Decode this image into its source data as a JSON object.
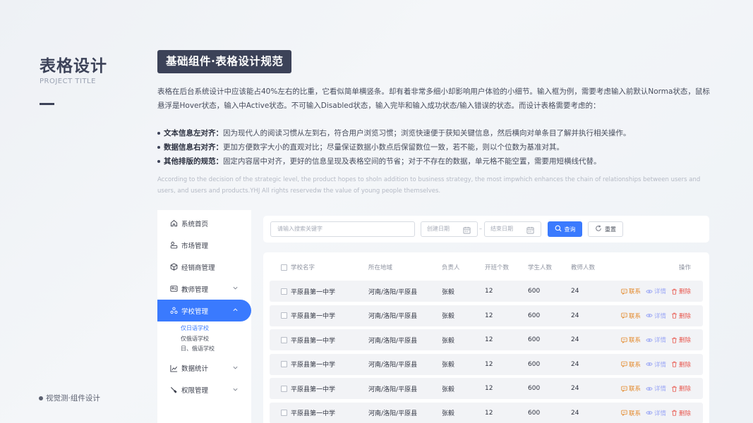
{
  "left": {
    "title": "表格设计",
    "subtitle": "PROJECT TITLE",
    "footer": "视觉测·组件设计"
  },
  "hero": {
    "title": "基础组件·表格设计规范",
    "intro": "表格在后台系统设计中应该能占40%左右的比重，它看似简单横竖条。却有着非常多细小却影响用户体验的小细节。输入框为例，需要考虑输入前默认Norma状态，鼠标悬浮是Hover状态，输入中Active状态。不可输入Disabled状态，输入完毕和输入成功状态/输入错误的状态。而设计表格需要考虑的：",
    "bullets": [
      {
        "label": "文本信息左对齐：",
        "text": "因为现代人的阅读习惯从左到右，符合用户浏览习惯；浏览快速便于获知关键信息，然后横向对单条目了解并执行相关操作。"
      },
      {
        "label": "数据信息右对齐：",
        "text": "更加方便数字大小的直观对比；尽量保证数据小数点后保留数位一致，若不能，则以个位数为基准对其。"
      },
      {
        "label": "其他排版的规范：",
        "text": "固定内容居中对齐，更好的信息呈现及表格空间的节省；对于不存在的数据，单元格不能空置，需要用短横线代替。"
      }
    ],
    "english": "According to the decision of the strategic level, the product hopes to sholn addition to business strategy, the most impwhich enhances the chain of relationships between users and users, and users and products.YHJ All rights reservedw the value of young people themselves."
  },
  "sidebar": {
    "items": [
      {
        "label": "系统首页",
        "icon": "home-icon"
      },
      {
        "label": "市场管理",
        "icon": "market-icon"
      },
      {
        "label": "经销商管理",
        "icon": "box-icon"
      },
      {
        "label": "教师管理",
        "icon": "teacher-icon"
      },
      {
        "label": "学校管理",
        "icon": "school-icon"
      },
      {
        "label": "数据统计",
        "icon": "chart-icon"
      },
      {
        "label": "权限管理",
        "icon": "permission-icon"
      }
    ],
    "school_sub": [
      "仅日语学校",
      "仅俄语学校",
      "日、俄语学校"
    ]
  },
  "filter": {
    "search_placeholder": "请输入搜索关键字",
    "start_placeholder": "创建日期",
    "end_placeholder": "结束日期",
    "separator": "–",
    "query_label": "查询",
    "reset_label": "重置"
  },
  "table": {
    "headers": [
      "学校名字",
      "所在地域",
      "负责人",
      "开班个数",
      "学生人数",
      "教师人数",
      "操作"
    ],
    "rows": [
      [
        "平原县第一中学",
        "河南/洛阳/平原县",
        "张毅",
        "12",
        "600",
        "24"
      ],
      [
        "平原县第一中学",
        "河南/洛阳/平原县",
        "张毅",
        "12",
        "600",
        "24"
      ],
      [
        "平原县第一中学",
        "河南/洛阳/平原县",
        "张毅",
        "12",
        "600",
        "24"
      ],
      [
        "平原县第一中学",
        "河南/洛阳/平原县",
        "张毅",
        "12",
        "600",
        "24"
      ],
      [
        "平原县第一中学",
        "河南/洛阳/平原县",
        "张毅",
        "12",
        "600",
        "24"
      ],
      [
        "平原县第一中学",
        "河南/洛阳/平原县",
        "张毅",
        "12",
        "600",
        "24"
      ]
    ],
    "actions": {
      "contact": "联系",
      "detail": "详情",
      "delete": "删除"
    }
  },
  "colors": {
    "accent": "#3a7afe",
    "dark": "#3c4258",
    "contact": "#e3882a",
    "detail": "#9da9f5",
    "delete": "#e8574e"
  }
}
